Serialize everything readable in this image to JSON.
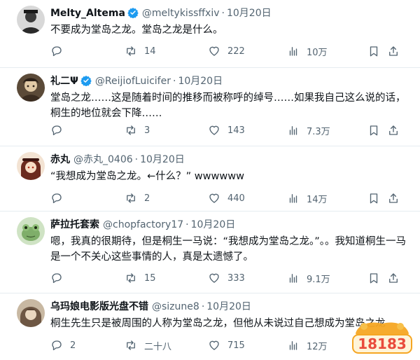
{
  "tweets": [
    {
      "name": "Melty_Altema",
      "handle": "@meltykissffxiv",
      "sep": "·",
      "date": "10月20日",
      "text": "不要成为堂岛之龙。堂岛之龙是什么。",
      "replies": "",
      "retweets": "14",
      "likes": "222",
      "views": "10万",
      "avatar_color": "#6b6b6b"
    },
    {
      "name": "礼二Ψ",
      "handle": "@ReijiofLuicifer",
      "sep": "·",
      "date": "10月20日",
      "text": "堂岛之龙……这是随着时间的推移而被称呼的绰号……如果我自己这么说的话，桐生的地位就会下降……",
      "replies": "",
      "retweets": "3",
      "likes": "143",
      "views": "7.3万",
      "avatar_color": "#4a3b2e"
    },
    {
      "name": "赤丸",
      "handle": "@赤丸_0406",
      "sep": "·",
      "date": "10月20日",
      "text": "“我想成为堂岛之龙。←什么？” wwwwww",
      "replies": "",
      "retweets": "2",
      "likes": "440",
      "views": "14万",
      "avatar_color": "#a0523c"
    },
    {
      "name": "萨拉托套索",
      "handle": "@chopfactory17",
      "sep": "·",
      "date": "10月20日",
      "text": "嗯，我真的很期待，但是桐生一马说：“我想成为堂岛之龙。”。。我知道桐生一马是一个不关心这些事情的人，真是太遗憾了。",
      "replies": "",
      "retweets": "15",
      "likes": "333",
      "views": "9.1万",
      "avatar_color": "#7fae6a"
    },
    {
      "name": "乌玛娘电影版光盘不错",
      "handle": "@sizune8",
      "sep": "·",
      "date": "10月20日",
      "text": "桐生先生只是被周围的人称为堂岛之龙，但他从未说过自己想成为堂岛之龙",
      "replies": "2",
      "retweets": "二十八",
      "likes": "715",
      "views": "12万",
      "avatar_color": "#8a7460"
    }
  ],
  "colors": {
    "text_primary": "#0f1419",
    "text_secondary": "#536471",
    "verified": "#1d9bf0",
    "divider": "#e6ecf0"
  },
  "watermark": {
    "text": "18183",
    "colors": [
      "#f5a623",
      "#e94b3c"
    ]
  }
}
